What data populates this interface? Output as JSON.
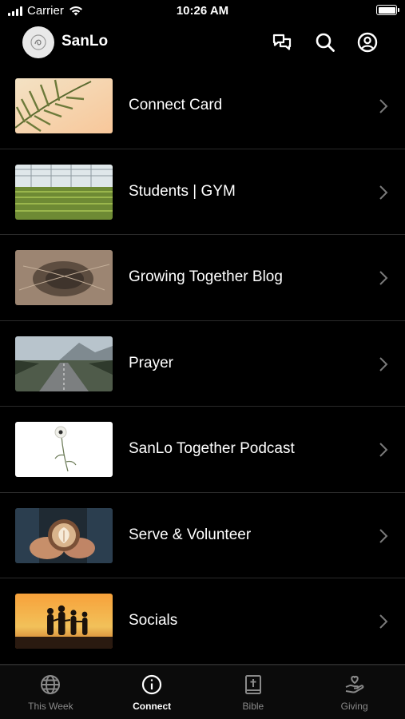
{
  "status_bar": {
    "carrier": "Carrier",
    "time": "10:26 AM"
  },
  "header": {
    "brand": "SanLo"
  },
  "items": [
    {
      "label": "Connect Card"
    },
    {
      "label": "Students | GYM"
    },
    {
      "label": "Growing Together Blog"
    },
    {
      "label": "Prayer"
    },
    {
      "label": "SanLo Together Podcast"
    },
    {
      "label": "Serve & Volunteer"
    },
    {
      "label": "Socials"
    }
  ],
  "tabs": [
    {
      "label": "This Week",
      "icon": "globe-icon",
      "active": false
    },
    {
      "label": "Connect",
      "icon": "info-icon",
      "active": true
    },
    {
      "label": "Bible",
      "icon": "bible-icon",
      "active": false
    },
    {
      "label": "Giving",
      "icon": "giving-hand-icon",
      "active": false
    }
  ],
  "colors": {
    "background": "#000000",
    "text": "#ffffff",
    "inactive": "#8a8a8a",
    "separator": "#2a2a2a"
  }
}
